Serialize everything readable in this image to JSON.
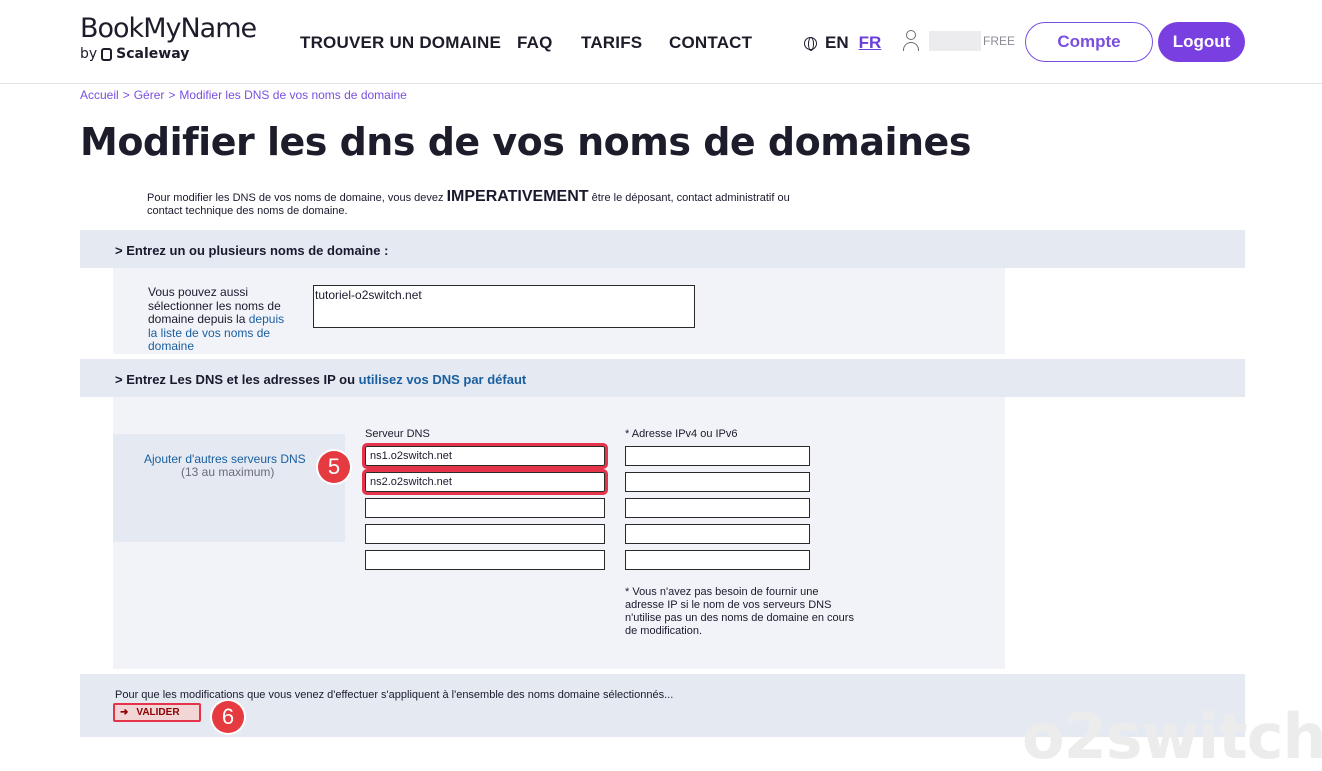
{
  "header": {
    "logo_main": "BookMyName",
    "logo_by": "by",
    "logo_brand": "Scaleway",
    "nav": [
      "TROUVER UN DOMAINE",
      "FAQ",
      "TARIFS",
      "CONTACT"
    ],
    "lang_en": "EN",
    "lang_fr": "FR",
    "user_plan": "FREE",
    "compte_label": "Compte",
    "logout_label": "Logout"
  },
  "breadcrumb": [
    "Accueil",
    ">",
    "Gérer",
    ">",
    "Modifier les DNS de vos noms de domaine"
  ],
  "page_title": "Modifier les dns de vos noms de domaines",
  "intro": {
    "part1": "Pour modifier les DNS de vos noms de domaine, vous devez",
    "strong": "IMPERATIVEMENT",
    "part2": "être le déposant, contact administratif ou contact technique des noms de domaine."
  },
  "section1": {
    "title": "> Entrez un ou plusieurs noms de domaine :",
    "side_text": "Vous pouvez aussi sélectionner les noms de domaine depuis la",
    "side_link": "depuis la liste de vos noms de domaine",
    "domains_value": "tutoriel-o2switch.net"
  },
  "section2": {
    "title_prefix": "> Entrez Les DNS et les adresses IP ou",
    "title_link": "utilisez vos DNS par défaut",
    "add_link": "Ajouter d'autres serveurs DNS",
    "add_max": "(13 au maximum)",
    "col_dns": "Serveur DNS",
    "col_ip": "* Adresse IPv4 ou IPv6",
    "dns_values": [
      "ns1.o2switch.net",
      "ns2.o2switch.net",
      "",
      "",
      ""
    ],
    "ip_values": [
      "",
      "",
      "",
      "",
      ""
    ],
    "note": "* Vous n'avez pas besoin de fournir une adresse IP si le nom de vos serveurs DNS n'utilise pas un des noms de domaine en cours de modification."
  },
  "footer": {
    "text": "Pour que les modifications que vous venez d'effectuer s'appliquent à l'ensemble des noms domaine sélectionnés...",
    "valider_label": "VALIDER"
  },
  "annotations": {
    "badge5": "5",
    "badge6": "6"
  },
  "watermark": "o2switch",
  "colors": {
    "accent": "#7a3fe0",
    "link": "#1a5fa0",
    "band": "#e4e9f2",
    "highlight": "#e5344a"
  }
}
